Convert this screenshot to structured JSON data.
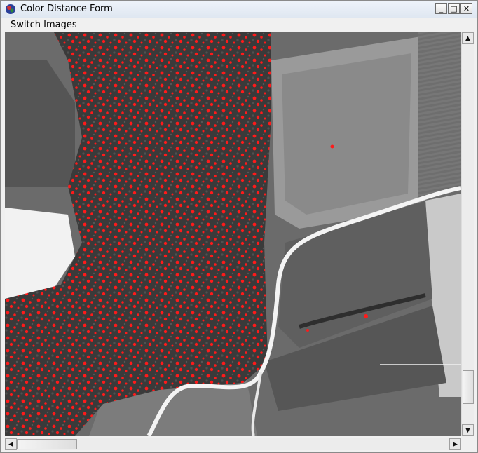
{
  "window": {
    "title": "Color Distance Form",
    "app_icon": "globe-icon"
  },
  "titlebar_buttons": {
    "minimize": "_",
    "maximize": "□",
    "close": "✕"
  },
  "menu": {
    "items": [
      {
        "label": "Switch Images"
      }
    ]
  },
  "image": {
    "description_icon": "aerial-photo",
    "highlight_color": "#ff1a1a"
  },
  "scrollbars": {
    "up_arrow": "▲",
    "down_arrow": "▼",
    "left_arrow": "◀",
    "right_arrow": "▶"
  }
}
